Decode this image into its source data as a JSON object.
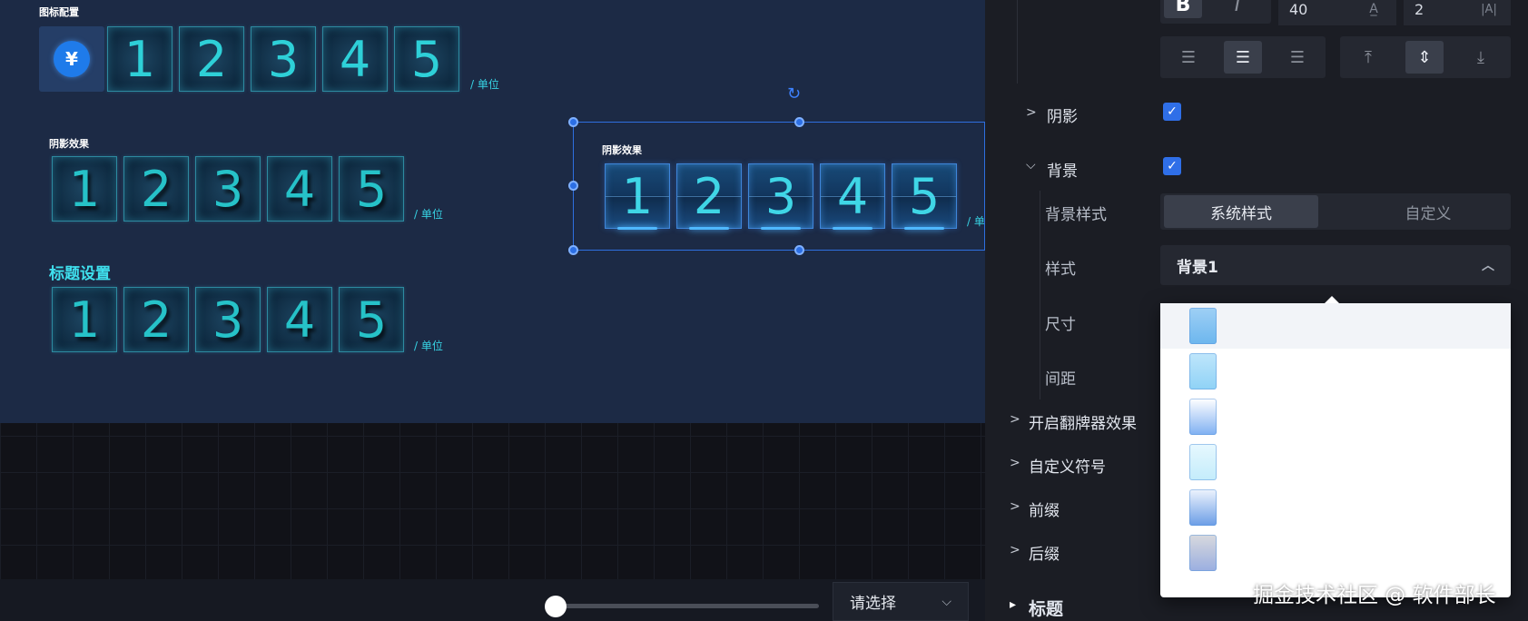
{
  "canvas": {
    "blocks": [
      {
        "caption": "图标配置",
        "digits": [
          "1",
          "2",
          "3",
          "4",
          "5"
        ],
        "unit": "/ 单位",
        "icon": "yuan-coin-icon"
      },
      {
        "caption": "阴影效果",
        "digits": [
          "1",
          "2",
          "3",
          "4",
          "5"
        ],
        "unit": "/ 单位"
      },
      {
        "caption": "标题设置",
        "digits": [
          "1",
          "2",
          "3",
          "4",
          "5"
        ],
        "unit": "/ 单位"
      }
    ],
    "selected_block": {
      "caption": "阴影效果",
      "digits": [
        "1",
        "2",
        "3",
        "4",
        "5"
      ],
      "unit": "/ 单"
    }
  },
  "bottom_bar": {
    "select_value": "请选择",
    "slider_value": 0
  },
  "panel": {
    "font_size_value": "40",
    "letter_spacing_value": "2",
    "bold_glyph": "B",
    "italic_glyph": "I",
    "sections": {
      "shadow": {
        "label": "阴影",
        "checked": true
      },
      "background": {
        "label": "背景",
        "checked": true
      },
      "flip": {
        "label": "开启翻牌器效果"
      },
      "custom_symbol": {
        "label": "自定义符号"
      },
      "prefix": {
        "label": "前缀"
      },
      "suffix": {
        "label": "后缀"
      },
      "title": {
        "label": "标题"
      }
    },
    "bg_style_label": "背景样式",
    "bg_style_options": [
      "系统样式",
      "自定义"
    ],
    "style_label": "样式",
    "style_value": "背景1",
    "size_label": "尺寸",
    "gap_label": "间距",
    "dropdown_swatches": [
      {
        "top": "#9fd0f5",
        "bottom": "#6cb6ee"
      },
      {
        "top": "#bfe6fb",
        "bottom": "#8fd2f6"
      },
      {
        "top": "#ffffff",
        "bottom": "#7fb0f2"
      },
      {
        "top": "#e7f8fe",
        "bottom": "#c3ecfb"
      },
      {
        "top": "#eef4fd",
        "bottom": "#6b9de6"
      },
      {
        "top": "#d8d9dd",
        "bottom": "#9aaee0"
      }
    ]
  },
  "watermark": "掘金技术社区 @ 软件部长"
}
